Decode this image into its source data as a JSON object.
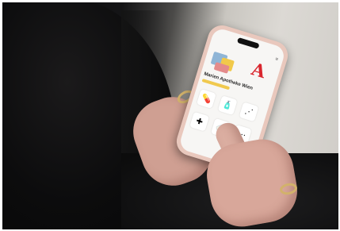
{
  "phone_app": {
    "store_name": "Marien Apotheke Wien",
    "logo_letter": "A",
    "tiles": [
      {
        "icon": "pill-box-icon",
        "glyph": "💊"
      },
      {
        "icon": "medicine-icon",
        "glyph": "🧴"
      },
      {
        "icon": "network-icon",
        "glyph": "⋰"
      },
      {
        "icon": "first-aid-icon",
        "glyph": "✚"
      },
      {
        "icon": "bottle-icon",
        "glyph": "🍼"
      },
      {
        "icon": "more-icon",
        "glyph": "⋯"
      }
    ]
  },
  "colors": {
    "logo_red": "#d9262e",
    "accent_yellow": "#f0c94e",
    "phone_case": "#e9c8bd"
  }
}
